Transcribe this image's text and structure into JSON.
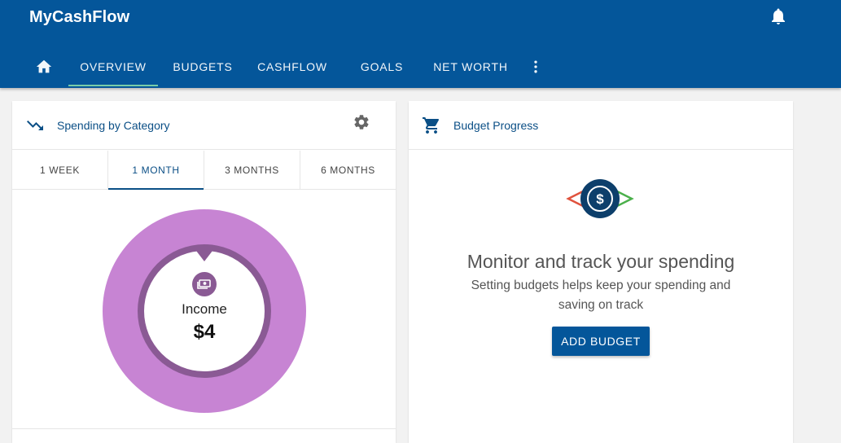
{
  "app": {
    "title": "MyCashFlow"
  },
  "nav": {
    "items": [
      {
        "label": "OVERVIEW"
      },
      {
        "label": "BUDGETS"
      },
      {
        "label": "CASHFLOW"
      },
      {
        "label": "GOALS"
      },
      {
        "label": "NET WORTH"
      }
    ]
  },
  "spending": {
    "title": "Spending by Category",
    "tabs": [
      "1 WEEK",
      "1 MONTH",
      "3 MONTHS",
      "6 MONTHS"
    ],
    "active_tab": "1 MONTH",
    "center_label": "Income",
    "center_value": "$4"
  },
  "budget": {
    "title": "Budget Progress",
    "heading": "Monitor and track your spending",
    "subtext": "Setting budgets helps keep your spending and saving on track",
    "button_label": "ADD BUDGET"
  },
  "colors": {
    "primary": "#04569a",
    "nav_indicator": "#7fd3a8",
    "donut_outer": "#c784d3",
    "donut_ring": "#8a5a94"
  },
  "icons": {
    "home": "home-icon",
    "bell": "bell-icon",
    "more": "more-vert-icon",
    "trend": "trending-down-icon",
    "gear": "gear-icon",
    "cart": "cart-icon",
    "money": "money-icon",
    "dollar": "dollar-circle-icon"
  }
}
